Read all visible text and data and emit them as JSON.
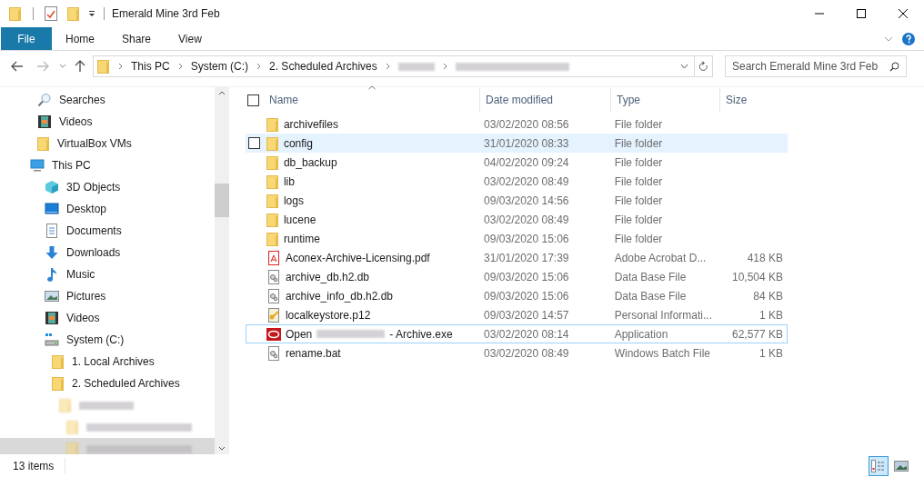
{
  "window": {
    "title": "Emerald Mine 3rd Feb"
  },
  "ribbon_tabs": [
    {
      "label": "File",
      "kind": "menu"
    },
    {
      "label": "Home",
      "kind": "tab"
    },
    {
      "label": "Share",
      "kind": "tab"
    },
    {
      "label": "View",
      "kind": "tab"
    }
  ],
  "address": {
    "crumbs": [
      {
        "kind": "text",
        "label": "This PC"
      },
      {
        "kind": "text",
        "label": "System (C:)"
      },
      {
        "kind": "text",
        "label": "2. Scheduled Archives"
      },
      {
        "kind": "redacted"
      },
      {
        "kind": "redacted"
      }
    ]
  },
  "search": {
    "placeholder": "Search Emerald Mine 3rd Feb"
  },
  "nav": {
    "loose_items": [
      {
        "label": "Searches",
        "kind": "search",
        "selected": false
      },
      {
        "label": "Videos",
        "kind": "video",
        "selected": false
      },
      {
        "label": "VirtualBox VMs",
        "kind": "folder",
        "selected": false
      }
    ],
    "tree": [
      {
        "label": "This PC",
        "kind": "pc",
        "selected": false,
        "children": [
          {
            "label": "3D Objects",
            "kind": "cube",
            "selected": false
          },
          {
            "label": "Desktop",
            "kind": "desktop",
            "selected": false
          },
          {
            "label": "Documents",
            "kind": "doc",
            "selected": false
          },
          {
            "label": "Downloads",
            "kind": "download",
            "selected": false
          },
          {
            "label": "Music",
            "kind": "music",
            "selected": false
          },
          {
            "label": "Pictures",
            "kind": "picture",
            "selected": false
          },
          {
            "label": "Videos",
            "kind": "video",
            "selected": false
          },
          {
            "label": "System (C:)",
            "kind": "drive",
            "selected": false,
            "children": [
              {
                "label": "1. Local Archives",
                "kind": "folder",
                "selected": false
              },
              {
                "label": "2. Scheduled Archives",
                "kind": "folder",
                "selected": false,
                "children": [
                  {
                    "kind": "redacted",
                    "selected": false,
                    "children": [
                      {
                        "kind": "redacted",
                        "selected": false
                      },
                      {
                        "kind": "redacted",
                        "selected": true
                      }
                    ]
                  }
                ]
              }
            ]
          }
        ]
      }
    ]
  },
  "select_all": {
    "checked": false
  },
  "columns": [
    {
      "label": "Name",
      "sorted": true
    },
    {
      "label": "Date modified",
      "sorted": false
    },
    {
      "label": "Type",
      "sorted": false
    },
    {
      "label": "Size",
      "sorted": false
    }
  ],
  "rows": [
    {
      "name": "archivefiles",
      "kind": "folder",
      "date": "03/02/2020 08:56",
      "type": "File folder",
      "hover": false,
      "focused": false
    },
    {
      "name": "config",
      "kind": "folder",
      "date": "31/01/2020 08:33",
      "type": "File folder",
      "hover": true,
      "focused": false
    },
    {
      "name": "db_backup",
      "kind": "folder",
      "date": "04/02/2020 09:24",
      "type": "File folder",
      "hover": false,
      "focused": false
    },
    {
      "name": "lib",
      "kind": "folder",
      "date": "03/02/2020 08:49",
      "type": "File folder",
      "hover": false,
      "focused": false
    },
    {
      "name": "logs",
      "kind": "folder",
      "date": "09/03/2020 14:56",
      "type": "File folder",
      "hover": false,
      "focused": false
    },
    {
      "name": "lucene",
      "kind": "folder",
      "date": "03/02/2020 08:49",
      "type": "File folder",
      "hover": false,
      "focused": false
    },
    {
      "name": "runtime",
      "kind": "folder",
      "date": "09/03/2020 15:06",
      "type": "File folder",
      "hover": false,
      "focused": false
    },
    {
      "name": "Aconex-Archive-Licensing.pdf",
      "kind": "pdf",
      "date": "31/01/2020 17:39",
      "type": "Adobe Acrobat D...",
      "size": "418 KB",
      "hover": false,
      "focused": false
    },
    {
      "name": "archive_db.h2.db",
      "kind": "db",
      "date": "09/03/2020 15:06",
      "type": "Data Base File",
      "size": "10,504 KB",
      "hover": false,
      "focused": false
    },
    {
      "name": "archive_info_db.h2.db",
      "kind": "db",
      "date": "09/03/2020 15:06",
      "type": "Data Base File",
      "size": "84 KB",
      "hover": false,
      "focused": false
    },
    {
      "name": "localkeystore.p12",
      "kind": "key",
      "date": "09/03/2020 14:57",
      "type": "Personal Informati...",
      "size": "1 KB",
      "hover": false,
      "focused": false
    },
    {
      "name": "Open",
      "name_end": "- Archive.exe",
      "kind": "app",
      "date": "03/02/2020 08:14",
      "type": "Application",
      "size": "62,577 KB",
      "hover": false,
      "focused": true
    },
    {
      "name": "rename.bat",
      "kind": "db",
      "date": "03/02/2020 08:49",
      "type": "Windows Batch File",
      "size": "1 KB",
      "hover": false,
      "focused": false
    }
  ],
  "status_bar": {
    "count": "13 items"
  },
  "views": [
    {
      "kind": "details",
      "selected": true
    },
    {
      "kind": "large-icons",
      "selected": false
    }
  ]
}
